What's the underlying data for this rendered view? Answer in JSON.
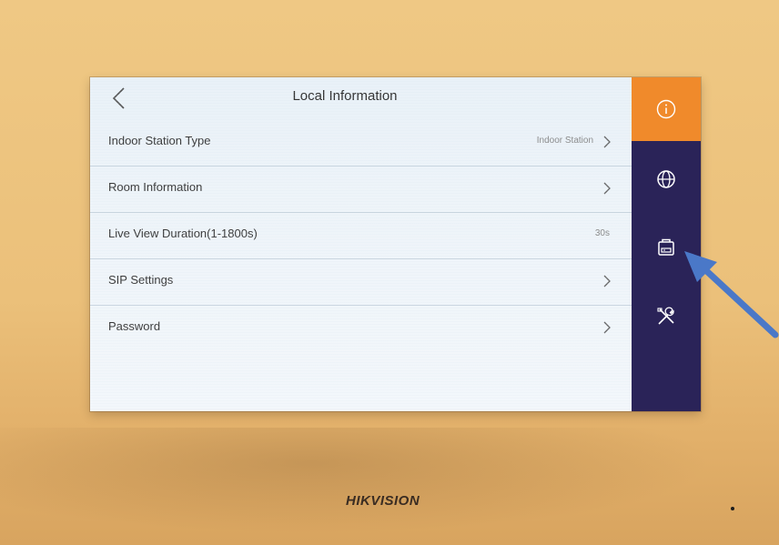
{
  "header": {
    "title": "Local Information",
    "back_icon": "chevron-left-icon"
  },
  "rows": [
    {
      "label": "Indoor Station Type",
      "value": "Indoor Station",
      "chevron": true
    },
    {
      "label": "Room Information",
      "value": "",
      "chevron": true
    },
    {
      "label": "Live View Duration(1-1800s)",
      "value": "30s",
      "chevron": false
    },
    {
      "label": "SIP Settings",
      "value": "",
      "chevron": true
    },
    {
      "label": "Password",
      "value": "",
      "chevron": true
    }
  ],
  "sidebar": {
    "items": [
      {
        "icon": "info-icon",
        "active": true
      },
      {
        "icon": "globe-icon",
        "active": false
      },
      {
        "icon": "device-icon",
        "active": false
      },
      {
        "icon": "tools-icon",
        "active": false
      }
    ]
  },
  "device": {
    "brand": "HIKVISION"
  },
  "colors": {
    "accent_orange": "#f08a2b",
    "sidebar_bg": "#2a2358",
    "annotation_arrow": "#4a78c8"
  }
}
